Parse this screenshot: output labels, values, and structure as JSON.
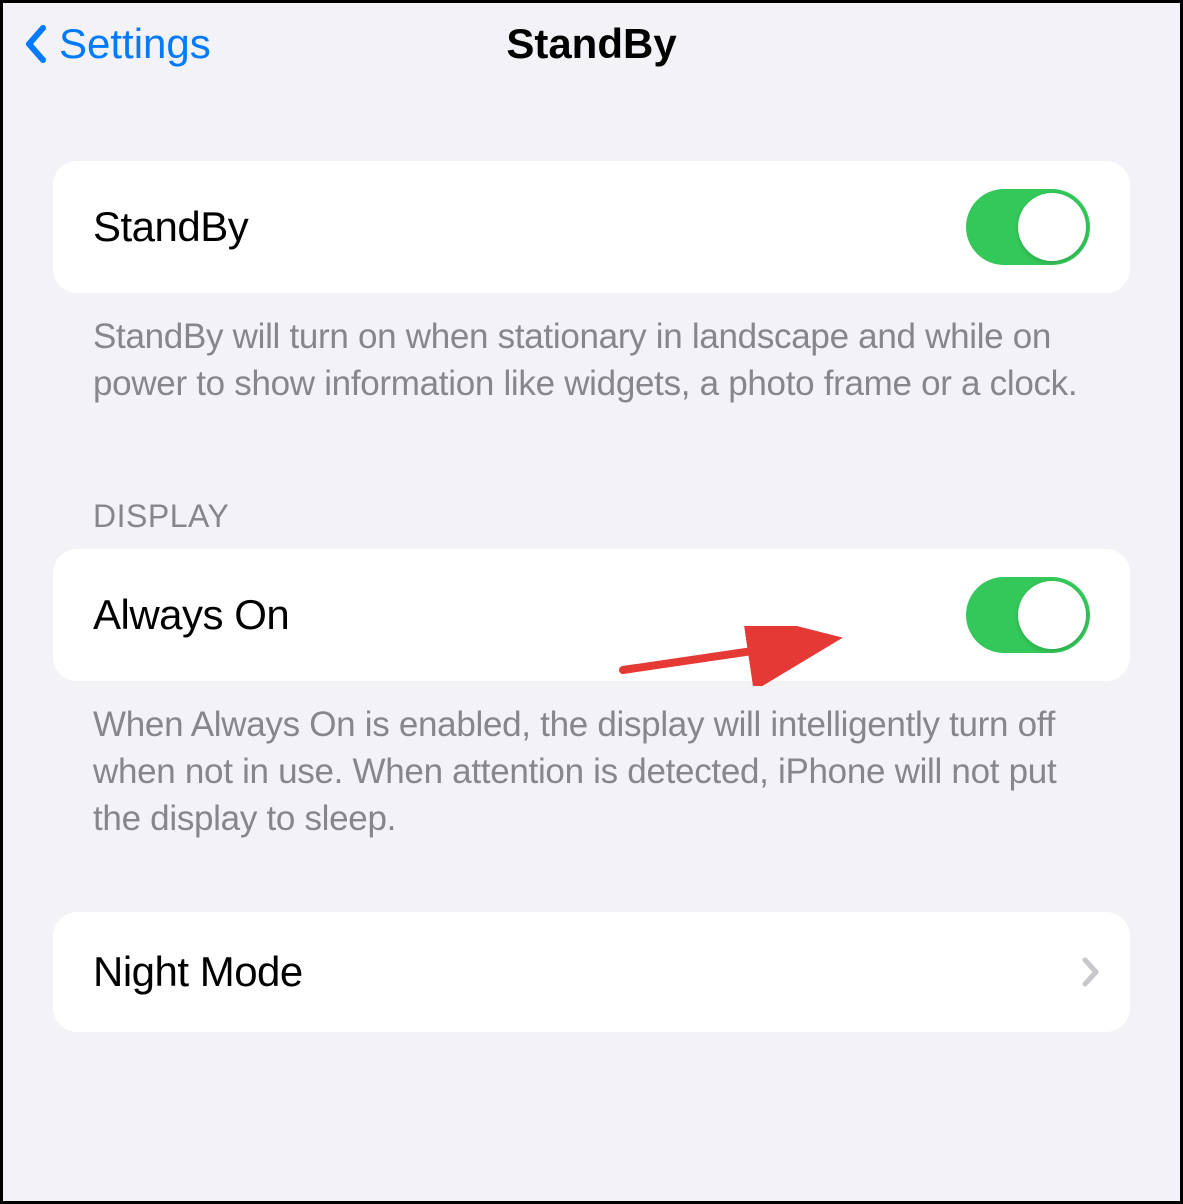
{
  "nav": {
    "back_label": "Settings",
    "title": "StandBy"
  },
  "section1": {
    "standby_label": "StandBy",
    "standby_toggle_on": true,
    "footer": "StandBy will turn on when stationary in landscape and while on power to show information like widgets, a photo frame or a clock."
  },
  "section2": {
    "header": "DISPLAY",
    "always_on_label": "Always On",
    "always_on_toggle_on": true,
    "footer": "When Always On is enabled, the display will intelligently turn off when not in use. When attention is detected, iPhone will not put the display to sleep."
  },
  "section3": {
    "night_mode_label": "Night Mode"
  },
  "colors": {
    "accent": "#007aff",
    "toggle_on": "#34c759",
    "bg": "#f2f2f7",
    "secondary_text": "#86868b"
  }
}
